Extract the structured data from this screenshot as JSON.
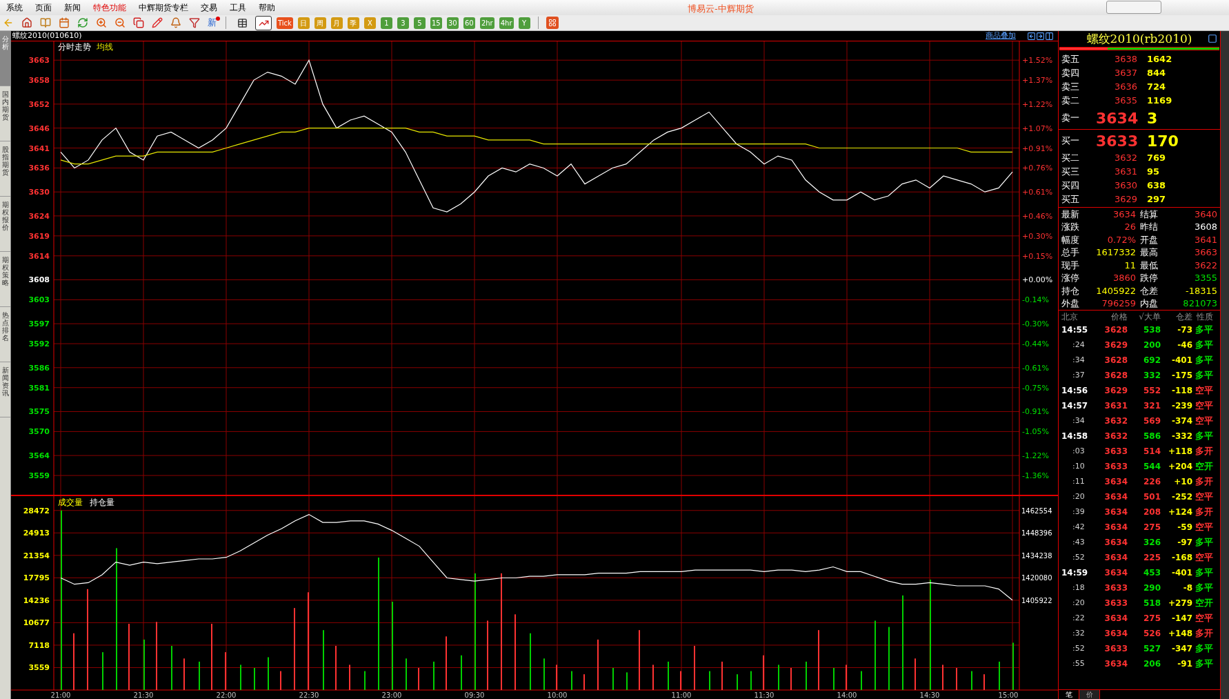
{
  "window": {
    "title": "博易云-中辉期货"
  },
  "menu": [
    {
      "label": "系统",
      "highlighted": false
    },
    {
      "label": "页面",
      "highlighted": false
    },
    {
      "label": "新闻",
      "highlighted": false
    },
    {
      "label": "特色功能",
      "highlighted": true
    },
    {
      "label": "中辉期货专栏",
      "highlighted": false
    },
    {
      "label": "交易",
      "highlighted": false
    },
    {
      "label": "工具",
      "highlighted": false
    },
    {
      "label": "帮助",
      "highlighted": false
    }
  ],
  "toolbar": {
    "news_badge": "新",
    "view_buttons": [
      {
        "kind": "table",
        "selected": false
      },
      {
        "kind": "chart",
        "selected": true
      }
    ],
    "periods": [
      {
        "label": "Tick",
        "color": "#e8501c"
      },
      {
        "label": "日",
        "color": "#d39a12"
      },
      {
        "label": "周",
        "color": "#d39a12"
      },
      {
        "label": "月",
        "color": "#d39a12"
      },
      {
        "label": "季",
        "color": "#d39a12"
      },
      {
        "label": "X",
        "color": "#d39a12"
      },
      {
        "label": "1",
        "color": "#4f9e3c"
      },
      {
        "label": "3",
        "color": "#4f9e3c"
      },
      {
        "label": "5",
        "color": "#4f9e3c"
      },
      {
        "label": "15",
        "color": "#4f9e3c"
      },
      {
        "label": "30",
        "color": "#4f9e3c"
      },
      {
        "label": "60",
        "color": "#4f9e3c"
      },
      {
        "label": "2hr",
        "color": "#4f9e3c"
      },
      {
        "label": "4hr",
        "color": "#4f9e3c"
      },
      {
        "label": "Y",
        "color": "#4f9e3c"
      }
    ]
  },
  "side_tabs": [
    {
      "label": "分析",
      "selected": true
    },
    {
      "label": "国内期货",
      "selected": false
    },
    {
      "label": "股指期货",
      "selected": false
    },
    {
      "label": "期权报价",
      "selected": false
    },
    {
      "label": "期权策略",
      "selected": false
    },
    {
      "label": "热点排名",
      "selected": false
    },
    {
      "label": "新闻资讯",
      "selected": false
    }
  ],
  "chart_header": {
    "symbol": "螺纹2010(010610)",
    "overlay_link": "商品叠加"
  },
  "price_pane": {
    "percent_axis": [
      {
        "label": "+1.52%",
        "color": "#ff3232"
      },
      {
        "label": "+1.37%",
        "color": "#ff3232"
      },
      {
        "label": "+1.22%",
        "color": "#ff3232"
      },
      {
        "label": "+1.07%",
        "color": "#ff3232"
      },
      {
        "label": "+0.91%",
        "color": "#ff3232"
      },
      {
        "label": "+0.76%",
        "color": "#ff3232"
      },
      {
        "label": "+0.61%",
        "color": "#ff3232"
      },
      {
        "label": "+0.46%",
        "color": "#ff3232"
      },
      {
        "label": "+0.30%",
        "color": "#ff3232"
      },
      {
        "label": "+0.15%",
        "color": "#ff3232"
      },
      {
        "label": "+0.00%",
        "color": "#ffffff"
      },
      {
        "label": "-0.14%",
        "color": "#00e000"
      },
      {
        "label": "-0.30%",
        "color": "#00e000"
      },
      {
        "label": "-0.44%",
        "color": "#00e000"
      },
      {
        "label": "-0.61%",
        "color": "#00e000"
      },
      {
        "label": "-0.75%",
        "color": "#00e000"
      },
      {
        "label": "-0.91%",
        "color": "#00e000"
      },
      {
        "label": "-1.05%",
        "color": "#00e000"
      },
      {
        "label": "-1.22%",
        "color": "#00e000"
      },
      {
        "label": "-1.36%",
        "color": "#00e000"
      }
    ],
    "chart_data": {
      "type": "line",
      "grid": true,
      "ylim": [
        3554,
        3667.7
      ],
      "yticks": [
        {
          "value": 3663,
          "label": "3663"
        },
        {
          "value": 3658,
          "label": "3658"
        },
        {
          "value": 3652,
          "label": "3652"
        },
        {
          "value": 3646,
          "label": "3646"
        },
        {
          "value": 3641,
          "label": "3641"
        },
        {
          "value": 3636,
          "label": "3636"
        },
        {
          "value": 3630,
          "label": "3630"
        },
        {
          "value": 3624,
          "label": "3624"
        },
        {
          "value": 3619,
          "label": "3619"
        },
        {
          "value": 3614,
          "label": "3614"
        },
        {
          "value": 3608,
          "label": "3608"
        },
        {
          "value": 3603,
          "label": "3603"
        },
        {
          "value": 3597,
          "label": "3597"
        },
        {
          "value": 3592,
          "label": "3592"
        },
        {
          "value": 3586,
          "label": "3586"
        },
        {
          "value": 3581,
          "label": "3581"
        },
        {
          "value": 3575,
          "label": "3575"
        },
        {
          "value": 3570,
          "label": "3570"
        },
        {
          "value": 3564,
          "label": "3564"
        },
        {
          "value": 3559,
          "label": "3559"
        }
      ],
      "series": [
        {
          "name": "分时走势",
          "color": "#ffffff",
          "values": [
            3640,
            3636,
            3638,
            3643,
            3646,
            3640,
            3638,
            3644,
            3645,
            3643,
            3641,
            3643,
            3646,
            3652,
            3658,
            3660,
            3659,
            3657,
            3663,
            3652,
            3646,
            3648,
            3649,
            3647,
            3645,
            3640,
            3633,
            3626,
            3625,
            3627,
            3630,
            3634,
            3636,
            3635,
            3637,
            3636,
            3634,
            3637,
            3632,
            3634,
            3636,
            3637,
            3640,
            3643,
            3645,
            3646,
            3648,
            3650,
            3646,
            3642,
            3640,
            3637,
            3639,
            3638,
            3633,
            3630,
            3628,
            3628,
            3630,
            3628,
            3629,
            3632,
            3633,
            3631,
            3634,
            3633,
            3632,
            3630,
            3631,
            3635
          ]
        },
        {
          "name": "均线",
          "color": "#e8e800",
          "values": [
            3638,
            3637,
            3637,
            3638,
            3639,
            3639,
            3639,
            3640,
            3640,
            3640,
            3640,
            3640,
            3641,
            3642,
            3643,
            3644,
            3645,
            3645,
            3646,
            3646,
            3646,
            3646,
            3646,
            3646,
            3646,
            3646,
            3645,
            3645,
            3644,
            3644,
            3644,
            3643,
            3643,
            3643,
            3643,
            3642,
            3642,
            3642,
            3642,
            3642,
            3642,
            3642,
            3642,
            3642,
            3642,
            3642,
            3642,
            3642,
            3642,
            3642,
            3642,
            3642,
            3642,
            3642,
            3642,
            3641,
            3641,
            3641,
            3641,
            3641,
            3641,
            3641,
            3641,
            3641,
            3641,
            3641,
            3640,
            3640,
            3640,
            3640
          ]
        }
      ]
    }
  },
  "volume_pane": {
    "chart_data": {
      "type": "bar",
      "grid": true,
      "ylim": [
        0,
        30855
      ],
      "categories": [
        "21:00",
        null,
        null,
        null,
        null,
        null,
        "21:30",
        null,
        null,
        null,
        null,
        null,
        "22:00",
        null,
        null,
        null,
        null,
        null,
        "22:30",
        null,
        null,
        null,
        null,
        null,
        "23:00",
        null,
        null,
        null,
        null,
        null,
        "09:30",
        null,
        null,
        null,
        null,
        null,
        "10:00",
        null,
        null,
        null,
        null,
        null,
        null,
        null,
        null,
        "11:00",
        null,
        null,
        null,
        null,
        null,
        "11:30",
        null,
        null,
        null,
        null,
        null,
        "14:00",
        null,
        null,
        null,
        null,
        null,
        "14:30",
        null,
        null,
        null,
        null,
        null,
        "15:00"
      ],
      "yticks": [
        28472,
        24913,
        21354,
        17795,
        14236,
        10677,
        7118,
        3559
      ],
      "series": [
        {
          "name": "成交量",
          "color": "#ff3232",
          "values": [
            null,
            9000,
            16000,
            null,
            null,
            10500,
            null,
            10800,
            null,
            5000,
            null,
            10500,
            6000,
            null,
            null,
            null,
            3000,
            13000,
            15500,
            null,
            7000,
            4000,
            null,
            null,
            null,
            null,
            3500,
            null,
            8500,
            null,
            null,
            11000,
            18500,
            12000,
            null,
            null,
            4000,
            null,
            2500,
            8000,
            null,
            null,
            9500,
            4000,
            null,
            3000,
            7000,
            null,
            4500,
            null,
            null,
            5500,
            null,
            3500,
            null,
            9500,
            null,
            4000,
            null,
            null,
            null,
            null,
            5000,
            null,
            4000,
            3500,
            null,
            2500,
            null,
            null
          ]
        },
        {
          "color": "#00d000",
          "values": [
            28472,
            null,
            null,
            6000,
            22500,
            null,
            8000,
            null,
            7000,
            null,
            4500,
            null,
            null,
            4000,
            3500,
            5200,
            null,
            null,
            null,
            9500,
            null,
            null,
            3000,
            21000,
            14000,
            5000,
            null,
            4500,
            null,
            5500,
            18500,
            null,
            null,
            null,
            9000,
            5000,
            null,
            3000,
            null,
            null,
            3500,
            2800,
            null,
            null,
            4500,
            null,
            null,
            3000,
            null,
            2500,
            3000,
            null,
            4000,
            null,
            4500,
            null,
            3500,
            null,
            3000,
            11000,
            10000,
            15000,
            null,
            17500,
            null,
            null,
            3000,
            null,
            4500,
            7500
          ]
        }
      ]
    }
  },
  "open_interest_pane": {
    "chart_data": {
      "type": "line",
      "ylim": [
        1349290,
        1472032
      ],
      "yticks": [
        1462554,
        1448396,
        1434238,
        1420080,
        1405922
      ],
      "series": [
        {
          "name": "持仓量",
          "color": "#ffffff",
          "values": [
            1420000,
            1416000,
            1417000,
            1422000,
            1430000,
            1428000,
            1430000,
            1429000,
            1430000,
            1431000,
            1432000,
            1432000,
            1433000,
            1437000,
            1442000,
            1447000,
            1451000,
            1456000,
            1460000,
            1455000,
            1455000,
            1456000,
            1456000,
            1454000,
            1450000,
            1445000,
            1440000,
            1430000,
            1420000,
            1419000,
            1418000,
            1419000,
            1420000,
            1420000,
            1421000,
            1421000,
            1422000,
            1422000,
            1422000,
            1423000,
            1423000,
            1423000,
            1424000,
            1424000,
            1424000,
            1424000,
            1425000,
            1425000,
            1425000,
            1425000,
            1425000,
            1424000,
            1425000,
            1425000,
            1424000,
            1425000,
            1427000,
            1424000,
            1424000,
            1421000,
            1418000,
            1416000,
            1416000,
            1417000,
            1416000,
            1415000,
            1415000,
            1415000,
            1413000,
            1406000
          ]
        }
      ]
    }
  },
  "quote": {
    "title": "螺纹2010(rb2010)",
    "outer_share": {
      "level": 0.3
    },
    "book": [
      {
        "kind": "level",
        "label": "卖五",
        "price": "3638",
        "volume": "1642"
      },
      {
        "kind": "level",
        "label": "卖四",
        "price": "3637",
        "volume": "844"
      },
      {
        "kind": "level",
        "label": "卖三",
        "price": "3636",
        "volume": "724"
      },
      {
        "kind": "level",
        "label": "卖二",
        "price": "3635",
        "volume": "1169"
      },
      {
        "kind": "best",
        "label": "卖一",
        "price": "3634",
        "volume": "3"
      },
      {
        "kind": "divider"
      },
      {
        "kind": "best",
        "label": "买一",
        "price": "3633",
        "volume": "170"
      },
      {
        "kind": "level",
        "label": "买二",
        "price": "3632",
        "volume": "769"
      },
      {
        "kind": "level",
        "label": "买三",
        "price": "3631",
        "volume": "95"
      },
      {
        "kind": "level",
        "label": "买四",
        "price": "3630",
        "volume": "638"
      },
      {
        "kind": "level",
        "label": "买五",
        "price": "3629",
        "volume": "297"
      }
    ],
    "stats": [
      [
        {
          "label": "最新",
          "value": "3634",
          "color": "#ff3232"
        },
        {
          "label": "结算",
          "value": "3640",
          "color": "#ff3232"
        }
      ],
      [
        {
          "label": "涨跌",
          "value": "26",
          "color": "#ff3232"
        },
        {
          "label": "昨结",
          "value": "3608",
          "color": "#ffffff"
        }
      ],
      [
        {
          "label": "幅度",
          "value": "0.72%",
          "color": "#ff3232"
        },
        {
          "label": "开盘",
          "value": "3641",
          "color": "#ff3232"
        }
      ],
      [
        {
          "label": "总手",
          "value": "1617332",
          "color": "#ffff00"
        },
        {
          "label": "最高",
          "value": "3663",
          "color": "#ff3232"
        }
      ],
      [
        {
          "label": "现手",
          "value": "11",
          "color": "#ffff00"
        },
        {
          "label": "最低",
          "value": "3622",
          "color": "#ff3232"
        }
      ],
      [
        {
          "label": "涨停",
          "value": "3860",
          "color": "#ff3232"
        },
        {
          "label": "跌停",
          "value": "3355",
          "color": "#00e000"
        }
      ],
      [
        {
          "label": "持仓",
          "value": "1405922",
          "color": "#ffff00"
        },
        {
          "label": "仓差",
          "value": "-18315",
          "color": "#ffff00"
        }
      ],
      [
        {
          "label": "外盘",
          "value": "796259",
          "color": "#ff3232"
        },
        {
          "label": "内盘",
          "value": "821073",
          "color": "#00e000"
        }
      ]
    ],
    "tick_columns": [
      "北京",
      "价格",
      "√大单",
      "仓差",
      "性质"
    ],
    "ticks": [
      {
        "kind": "minute",
        "time": "14:55",
        "price": "3628",
        "volume": {
          "value": "538",
          "color": "#00e000"
        },
        "change": "-73",
        "nature": {
          "value": "多平",
          "color": "#00e000"
        }
      },
      {
        "kind": "second",
        "time": ":24",
        "price": "3629",
        "volume": {
          "value": "200",
          "color": "#00e000"
        },
        "change": "-46",
        "nature": {
          "value": "多平",
          "color": "#00e000"
        }
      },
      {
        "kind": "second",
        "time": ":34",
        "price": "3628",
        "volume": {
          "value": "692",
          "color": "#00e000"
        },
        "change": "-401",
        "nature": {
          "value": "多平",
          "color": "#00e000"
        }
      },
      {
        "kind": "second",
        "time": ":37",
        "price": "3628",
        "volume": {
          "value": "332",
          "color": "#00e000"
        },
        "change": "-175",
        "nature": {
          "value": "多平",
          "color": "#00e000"
        }
      },
      {
        "kind": "minute",
        "time": "14:56",
        "price": "3629",
        "volume": {
          "value": "552",
          "color": "#ff3232"
        },
        "change": "-118",
        "nature": {
          "value": "空平",
          "color": "#ff3232"
        }
      },
      {
        "kind": "minute",
        "time": "14:57",
        "price": "3631",
        "volume": {
          "value": "321",
          "color": "#ff3232"
        },
        "change": "-239",
        "nature": {
          "value": "空平",
          "color": "#ff3232"
        }
      },
      {
        "kind": "second",
        "time": ":34",
        "price": "3632",
        "volume": {
          "value": "569",
          "color": "#ff3232"
        },
        "change": "-374",
        "nature": {
          "value": "空平",
          "color": "#ff3232"
        }
      },
      {
        "kind": "minute",
        "time": "14:58",
        "price": "3632",
        "volume": {
          "value": "586",
          "color": "#00e000"
        },
        "change": "-332",
        "nature": {
          "value": "多平",
          "color": "#00e000"
        }
      },
      {
        "kind": "second",
        "time": ":03",
        "price": "3633",
        "volume": {
          "value": "514",
          "color": "#ff3232"
        },
        "change": "+118",
        "nature": {
          "value": "多开",
          "color": "#ff3232"
        }
      },
      {
        "kind": "second",
        "time": ":10",
        "price": "3633",
        "volume": {
          "value": "544",
          "color": "#00e000"
        },
        "change": "+204",
        "nature": {
          "value": "空开",
          "color": "#00e000"
        }
      },
      {
        "kind": "second",
        "time": ":11",
        "price": "3634",
        "volume": {
          "value": "226",
          "color": "#ff3232"
        },
        "change": "+10",
        "nature": {
          "value": "多开",
          "color": "#ff3232"
        }
      },
      {
        "kind": "second",
        "time": ":20",
        "price": "3634",
        "volume": {
          "value": "501",
          "color": "#ff3232"
        },
        "change": "-252",
        "nature": {
          "value": "空平",
          "color": "#ff3232"
        }
      },
      {
        "kind": "second",
        "time": ":39",
        "price": "3634",
        "volume": {
          "value": "208",
          "color": "#ff3232"
        },
        "change": "+124",
        "nature": {
          "value": "多开",
          "color": "#ff3232"
        }
      },
      {
        "kind": "second",
        "time": ":42",
        "price": "3634",
        "volume": {
          "value": "275",
          "color": "#ff3232"
        },
        "change": "-59",
        "nature": {
          "value": "空平",
          "color": "#ff3232"
        }
      },
      {
        "kind": "second",
        "time": ":43",
        "price": "3634",
        "volume": {
          "value": "326",
          "color": "#00e000"
        },
        "change": "-97",
        "nature": {
          "value": "多平",
          "color": "#00e000"
        }
      },
      {
        "kind": "second",
        "time": ":52",
        "price": "3634",
        "volume": {
          "value": "225",
          "color": "#ff3232"
        },
        "change": "-168",
        "nature": {
          "value": "空平",
          "color": "#ff3232"
        }
      },
      {
        "kind": "minute",
        "time": "14:59",
        "price": "3634",
        "volume": {
          "value": "453",
          "color": "#00e000"
        },
        "change": "-401",
        "nature": {
          "value": "多平",
          "color": "#00e000"
        }
      },
      {
        "kind": "second",
        "time": ":18",
        "price": "3633",
        "volume": {
          "value": "290",
          "color": "#00e000"
        },
        "change": "-8",
        "nature": {
          "value": "多平",
          "color": "#00e000"
        }
      },
      {
        "kind": "second",
        "time": ":20",
        "price": "3633",
        "volume": {
          "value": "518",
          "color": "#00e000"
        },
        "change": "+279",
        "nature": {
          "value": "空开",
          "color": "#00e000"
        }
      },
      {
        "kind": "second",
        "time": ":22",
        "price": "3634",
        "volume": {
          "value": "275",
          "color": "#ff3232"
        },
        "change": "-147",
        "nature": {
          "value": "空平",
          "color": "#ff3232"
        }
      },
      {
        "kind": "second",
        "time": ":32",
        "price": "3634",
        "volume": {
          "value": "526",
          "color": "#ff3232"
        },
        "change": "+148",
        "nature": {
          "value": "多开",
          "color": "#ff3232"
        }
      },
      {
        "kind": "second",
        "time": ":52",
        "price": "3633",
        "volume": {
          "value": "527",
          "color": "#00e000"
        },
        "change": "-347",
        "nature": {
          "value": "多平",
          "color": "#00e000"
        }
      },
      {
        "kind": "second",
        "time": ":55",
        "price": "3634",
        "volume": {
          "value": "206",
          "color": "#00e000"
        },
        "change": "-91",
        "nature": {
          "value": "多平",
          "color": "#00e000"
        }
      }
    ],
    "bottom_tabs": [
      {
        "label": "笔",
        "selected": true
      },
      {
        "label": "价",
        "selected": false
      }
    ]
  }
}
